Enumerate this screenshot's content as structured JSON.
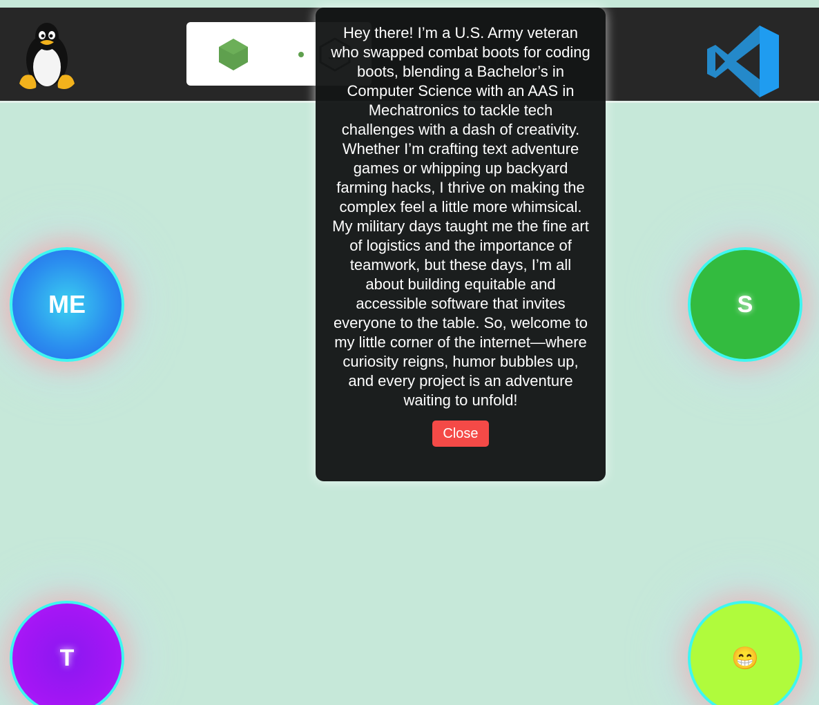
{
  "header": {
    "left_logo": "linux-tux-logo",
    "right_logo": "vscode-logo",
    "tech_icons": [
      "nodejs-hexagon-icon",
      "nodejs-js-icon",
      "bash-icon"
    ]
  },
  "modal": {
    "text": "Hey there! I’m a U.S. Army veteran who swapped combat boots for coding boots, blending a Bachelor’s in Computer Science with an AAS in Mechatronics to tackle tech challenges with a dash of creativity. Whether I’m crafting text adventure games or whipping up backyard farming hacks, I thrive on making the complex feel a little more whimsical. My military days taught me the fine art of logistics and the importance of teamwork, but these days, I’m all about building equitable and accessible software that invites everyone to the table. So, welcome to my little corner of the internet—where curiosity reigns, humor bubbles up, and every project is an adventure waiting to unfold!",
    "close_label": "Close"
  },
  "nav_orbs": {
    "me": "ME",
    "s": "S",
    "t": "T",
    "emoji": "😁"
  },
  "colors": {
    "background": "#c6e8d9",
    "header": "#272727",
    "close_button": "#f44a47",
    "orb_border": "#3ef6f0"
  }
}
